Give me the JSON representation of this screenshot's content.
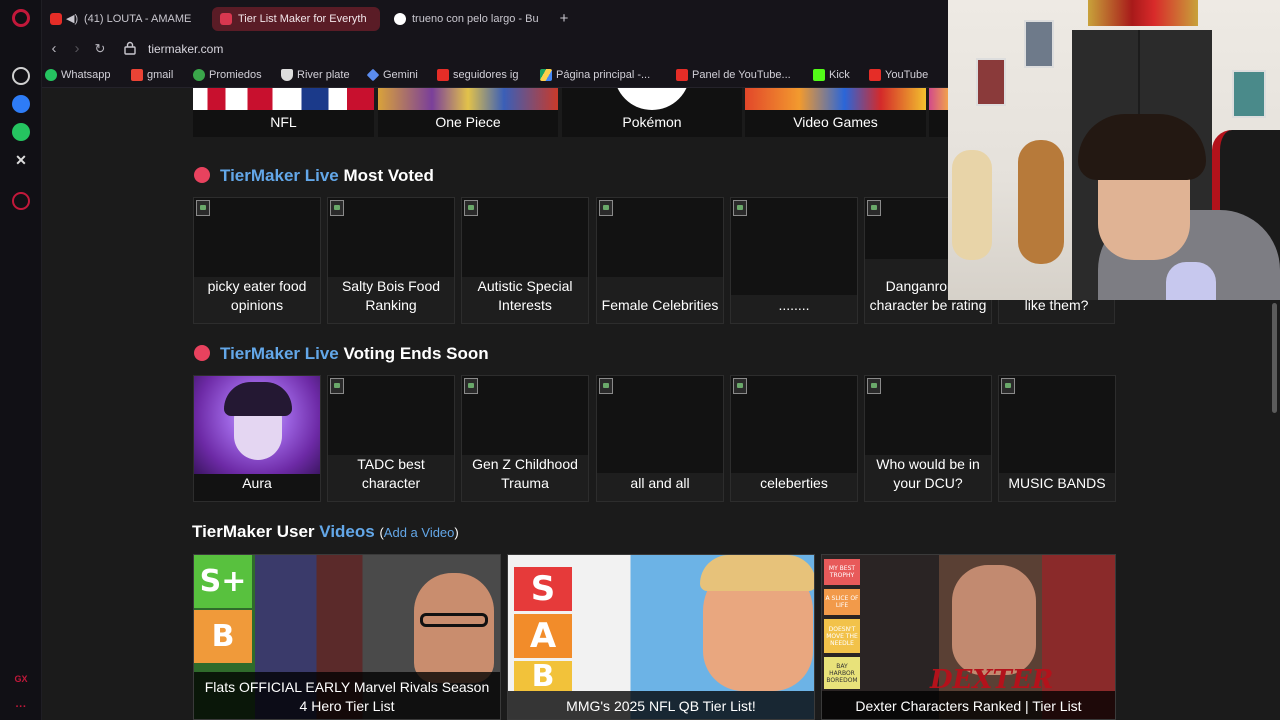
{
  "browser": {
    "tabs": [
      {
        "title": "(41) LOUTA - AMAME",
        "active": false
      },
      {
        "title": "Tier List Maker for Everyth",
        "active": true
      },
      {
        "title": "trueno con pelo largo - Bu",
        "active": false
      }
    ],
    "new_tab_label": "+",
    "url": "tiermaker.com",
    "bookmarks": [
      "Whatsapp",
      "gmail",
      "Promiedos",
      "River plate",
      "Gemini",
      "seguidores ig",
      "Página principal -...",
      "Panel de YouTube...",
      "Kick",
      "YouTube"
    ],
    "rail_footer": "GX",
    "rail_more": "···"
  },
  "categories": [
    "NFL",
    "One Piece",
    "Pokémon",
    "Video Games"
  ],
  "most_voted": {
    "title_brand": "TierMaker Live",
    "title_rest": "Most Voted",
    "items": [
      "picky eater food opinions",
      "Salty Bois Food Ranking",
      "Autistic Special Interests",
      "Female Celebrities",
      "........",
      "Danganronpa character be rating",
      "like them?"
    ]
  },
  "voting_ends": {
    "title_brand": "TierMaker Live",
    "title_rest": "Voting Ends Soon",
    "items": [
      "Aura",
      "TADC best character",
      "Gen Z Childhood Trauma",
      "all and all",
      "celeberties",
      "Who would be in your DCU?",
      "MUSIC BANDS"
    ]
  },
  "user_videos": {
    "title_prefix": "TierMaker User",
    "title_link": "Videos",
    "add_open": "(",
    "add_link": "Add a Video",
    "add_close": ")",
    "videos": [
      {
        "caption": "Flats OFFICIAL EARLY Marvel Rivals Season 4 Hero Tier List",
        "tiers": [
          "S+",
          "B"
        ]
      },
      {
        "caption": "MMG's 2025 NFL QB Tier List!",
        "tiers": [
          "S",
          "A",
          "B"
        ]
      },
      {
        "caption": "Dexter Characters Ranked | Tier List",
        "tiers": [
          "MY BEST TROPHY",
          "A SLICE OF LIFE",
          "DOESN'T MOVE THE NEEDLE",
          "BAY HARBOR BOREDOM"
        ],
        "overlay_text": "DEXTER"
      }
    ]
  },
  "colors": {
    "accent_blue": "#63a7e8",
    "live_dot": "#e8425e",
    "page_bg": "#1b1b1b"
  }
}
